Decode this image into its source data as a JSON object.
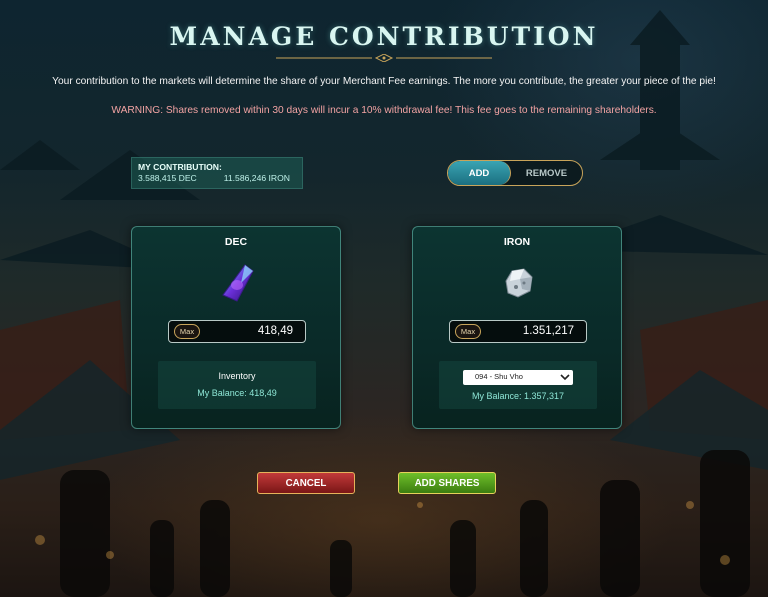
{
  "header": {
    "title": "MANAGE CONTRIBUTION",
    "intro": "Your contribution to the markets will determine the share of your Merchant Fee earnings. The more you contribute, the greater your piece of the pie!",
    "warning": "WARNING: Shares removed within 30 days will incur a 10% withdrawal fee! This fee goes to the remaining shareholders."
  },
  "contribution": {
    "label": "MY CONTRIBUTION:",
    "dec": "3.588,415 DEC",
    "iron": "11.586,246 IRON"
  },
  "mode_toggle": {
    "add_label": "ADD",
    "remove_label": "REMOVE",
    "selected": "ADD"
  },
  "dec_card": {
    "title": "DEC",
    "icon": "dec-crystal-icon",
    "max_label": "Max",
    "amount": "418,49",
    "source_label": "Inventory",
    "balance": "My Balance: 418,49"
  },
  "iron_card": {
    "title": "IRON",
    "icon": "iron-ore-icon",
    "max_label": "Max",
    "amount": "1.351,217",
    "source_select": "094 - Shu Vho",
    "balance": "My Balance: 1.357,317"
  },
  "actions": {
    "cancel_label": "CANCEL",
    "add_shares_label": "ADD SHARES"
  },
  "colors": {
    "accent_teal": "#1b6f80",
    "gold_border": "#c8a45a",
    "cancel_red": "#a12525",
    "add_green": "#55a01e",
    "warning_text": "#f2a3a3",
    "balance_text": "#8ee6d6"
  }
}
